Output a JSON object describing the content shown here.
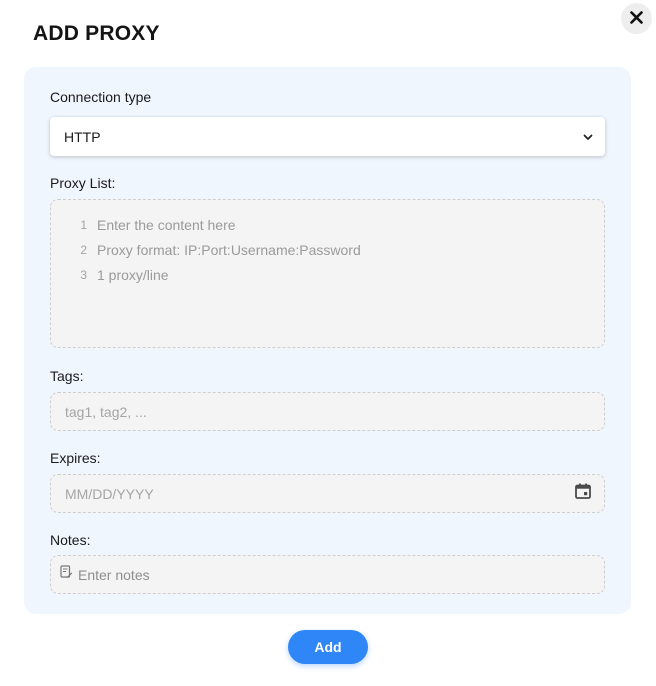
{
  "dialog": {
    "title": "ADD PROXY",
    "close_icon": "close-icon"
  },
  "connection_type": {
    "label": "Connection type",
    "selected": "HTTP",
    "chevron_icon": "chevron-down-icon"
  },
  "proxy_list": {
    "label": "Proxy List:",
    "lines": [
      {
        "num": "1",
        "text": "Enter the content here"
      },
      {
        "num": "2",
        "text": "Proxy format: IP:Port:Username:Password"
      },
      {
        "num": "3",
        "text": "1 proxy/line"
      }
    ]
  },
  "tags": {
    "label": "Tags:",
    "placeholder": "tag1, tag2, ..."
  },
  "expires": {
    "label": "Expires:",
    "placeholder": "MM/DD/YYYY",
    "calendar_icon": "calendar-icon"
  },
  "notes": {
    "label": "Notes:",
    "placeholder": "Enter notes",
    "notes_icon": "edit-note-icon"
  },
  "actions": {
    "add_label": "Add"
  },
  "colors": {
    "accent": "#2f86f6",
    "panel_bg": "#f0f6fe"
  }
}
